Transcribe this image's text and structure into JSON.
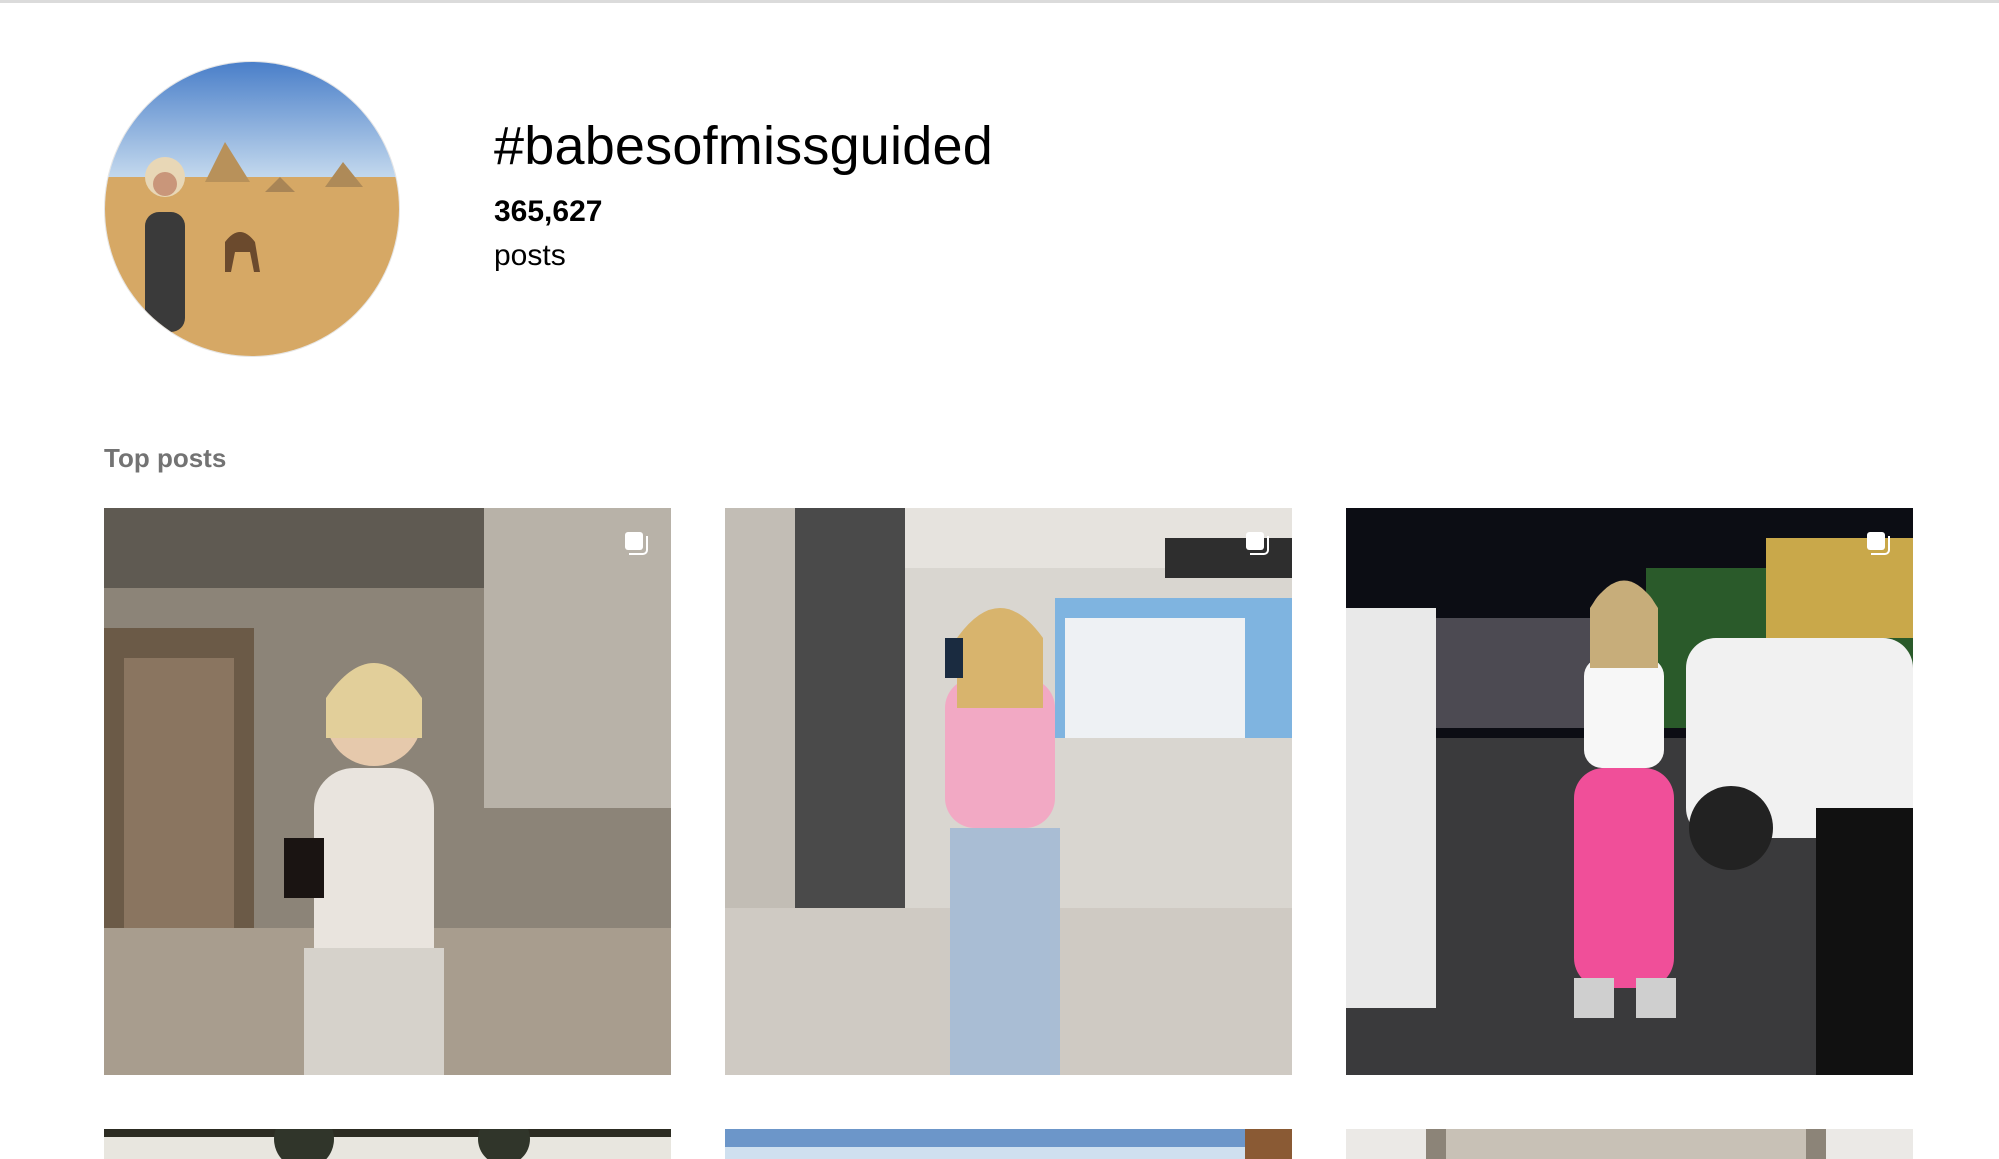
{
  "hashtag": {
    "title": "#babesofmissguided",
    "post_count": "365,627",
    "post_label": "posts"
  },
  "sections": {
    "top_posts_title": "Top posts"
  },
  "icons": {
    "multi_post": "carousel-icon"
  },
  "colors": {
    "border": "#dbdbdb",
    "section_title": "#737373"
  }
}
